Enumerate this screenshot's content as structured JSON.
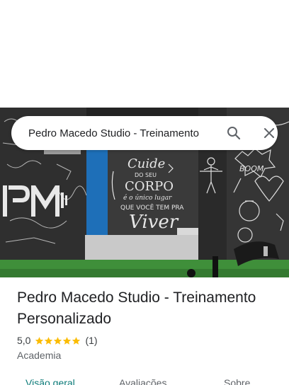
{
  "search": {
    "query": "Pedro Macedo Studio - Treinamento"
  },
  "photo": {
    "description_icon": "photo-gallery",
    "wall_text": [
      "Cuide",
      "DO SEU",
      "CORPO",
      "é o único lugar",
      "QUE VOCÊ TEM PRA",
      "Viver"
    ],
    "logo_text": "PM",
    "boom_text": "BOOM"
  },
  "place": {
    "title": "Pedro Macedo Studio - Treinamento Personalizado",
    "rating": "5,0",
    "stars": 5,
    "review_count": "(1)",
    "category": "Academia"
  },
  "tabs": [
    {
      "label": "Visão geral",
      "selected": true
    },
    {
      "label": "Avaliações",
      "selected": false
    },
    {
      "label": "Sobre",
      "selected": false
    }
  ],
  "colors": {
    "accent": "#0b7a78",
    "star": "#fbbc04",
    "text": "#202124",
    "secondary": "#5f6368"
  }
}
